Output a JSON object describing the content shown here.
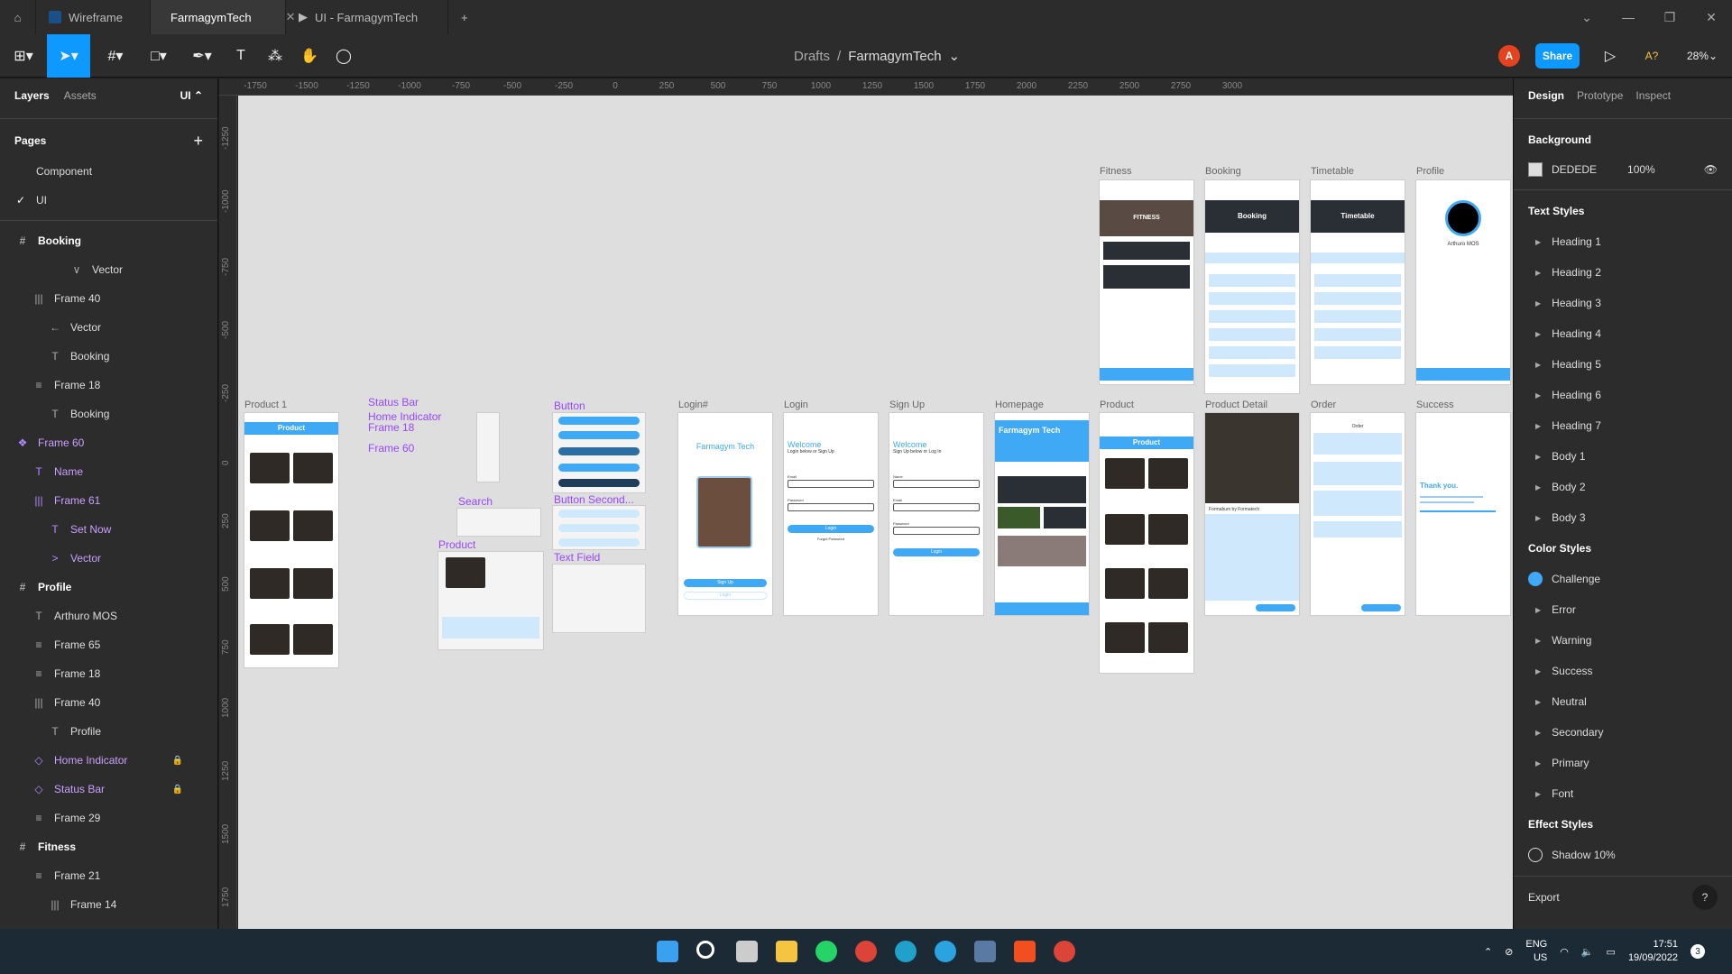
{
  "tabs": [
    {
      "label": "Wireframe",
      "active": false
    },
    {
      "label": "FarmagymTech",
      "active": true
    },
    {
      "label": "UI - FarmagymTech",
      "active": false
    }
  ],
  "toolbar": {
    "crumb_parent": "Drafts",
    "crumb_sep": "/",
    "file_name": "FarmagymTech",
    "avatar_letter": "A",
    "share_label": "Share",
    "zoom": "28%",
    "font_missing": "A?"
  },
  "left_panel": {
    "tab_layers": "Layers",
    "tab_assets": "Assets",
    "page_selector": "UI",
    "pages_title": "Pages",
    "pages": [
      "Component",
      "UI"
    ],
    "layers": [
      {
        "label": "Booking",
        "icon": "#",
        "indent": 18,
        "kind": "top"
      },
      {
        "label": "Vector",
        "icon": "∨",
        "indent": 78,
        "kind": ""
      },
      {
        "label": "Frame 40",
        "icon": "|||",
        "indent": 36,
        "kind": ""
      },
      {
        "label": "Vector",
        "icon": "←",
        "indent": 54,
        "kind": ""
      },
      {
        "label": "Booking",
        "icon": "T",
        "indent": 54,
        "kind": ""
      },
      {
        "label": "Frame 18",
        "icon": "≡",
        "indent": 36,
        "kind": ""
      },
      {
        "label": "Booking",
        "icon": "T",
        "indent": 54,
        "kind": ""
      },
      {
        "label": "Frame 60",
        "icon": "❖",
        "indent": 18,
        "kind": "comp"
      },
      {
        "label": "Name",
        "icon": "T",
        "indent": 36,
        "kind": "comp"
      },
      {
        "label": "Frame 61",
        "icon": "|||",
        "indent": 36,
        "kind": "comp"
      },
      {
        "label": "Set Now",
        "icon": "T",
        "indent": 54,
        "kind": "comp"
      },
      {
        "label": "Vector",
        "icon": ">",
        "indent": 54,
        "kind": "comp"
      },
      {
        "label": "Profile",
        "icon": "#",
        "indent": 18,
        "kind": "top"
      },
      {
        "label": "Arthuro MOS",
        "icon": "T",
        "indent": 36,
        "kind": ""
      },
      {
        "label": "Frame 65",
        "icon": "≡",
        "indent": 36,
        "kind": ""
      },
      {
        "label": "Frame 18",
        "icon": "≡",
        "indent": 36,
        "kind": ""
      },
      {
        "label": "Frame 40",
        "icon": "|||",
        "indent": 36,
        "kind": ""
      },
      {
        "label": "Profile",
        "icon": "T",
        "indent": 54,
        "kind": ""
      },
      {
        "label": "Home Indicator",
        "icon": "◇",
        "indent": 36,
        "kind": "comp",
        "locked": true
      },
      {
        "label": "Status Bar",
        "icon": "◇",
        "indent": 36,
        "kind": "comp",
        "locked": true
      },
      {
        "label": "Frame 29",
        "icon": "≡",
        "indent": 36,
        "kind": ""
      },
      {
        "label": "Fitness",
        "icon": "#",
        "indent": 18,
        "kind": "top"
      },
      {
        "label": "Frame 21",
        "icon": "≡",
        "indent": 36,
        "kind": ""
      },
      {
        "label": "Frame 14",
        "icon": "|||",
        "indent": 54,
        "kind": ""
      }
    ]
  },
  "ruler": {
    "x": [
      "-1750",
      "-1500",
      "-1250",
      "-1000",
      "-750",
      "-500",
      "-250",
      "0",
      "250",
      "500",
      "750",
      "1000",
      "1250",
      "1500",
      "1750",
      "2000",
      "2250",
      "2500",
      "2750",
      "3000"
    ],
    "y": [
      "-1250",
      "-1000",
      "-750",
      "-500",
      "-250",
      "0",
      "250",
      "500",
      "750",
      "1000",
      "1250",
      "1500",
      "1750"
    ]
  },
  "canvas": {
    "frame_labels": [
      "Product 1",
      "Login#",
      "Login",
      "Sign Up",
      "Homepage",
      "Product",
      "Product Detail",
      "Order",
      "Success",
      "Fitness",
      "Booking",
      "Timetable",
      "Profile"
    ],
    "component_labels": [
      "Status Bar",
      "Home Indicator",
      "Frame 18",
      "Frame 60",
      "Button",
      "Button Second...",
      "Search",
      "Product",
      "Text Field"
    ],
    "texts": {
      "product_title": "Product",
      "app_name": "Farmagym Tech",
      "welcome": "Welcome",
      "login_sub": "Login below or Sign Up",
      "signup_sub": "Sign Up below or Log In",
      "fitness": "FITNESS",
      "booking": "Booking",
      "timetable": "Timetable",
      "profile_name": "Arthuro MOS",
      "thank_you": "Thank you.",
      "detail_title": "Formabum by Formatech",
      "sign_up_btn": "Sign Up",
      "login_btn": "Login",
      "forgot": "Forgot Password",
      "email": "Email",
      "password": "Password",
      "name": "Name",
      "order": "Order",
      "search": "Search"
    }
  },
  "right_panel": {
    "tabs": [
      "Design",
      "Prototype",
      "Inspect"
    ],
    "background_title": "Background",
    "bg_hex": "DEDEDE",
    "bg_opacity": "100%",
    "text_styles_title": "Text Styles",
    "text_styles": [
      "Heading 1",
      "Heading 2",
      "Heading 3",
      "Heading 4",
      "Heading 5",
      "Heading 6",
      "Heading 7",
      "Body 1",
      "Body 2",
      "Body 3"
    ],
    "color_styles_title": "Color Styles",
    "color_styles": [
      "Challenge",
      "Error",
      "Warning",
      "Success",
      "Neutral",
      "Secondary",
      "Primary",
      "Font"
    ],
    "challenge_color": "#3fa9f5",
    "effect_styles_title": "Effect Styles",
    "effect_style": "Shadow 10%",
    "export_title": "Export",
    "help": "?"
  },
  "taskbar": {
    "lang": "ENG",
    "region": "US",
    "time": "17:51",
    "date": "19/09/2022",
    "badge": "3"
  }
}
